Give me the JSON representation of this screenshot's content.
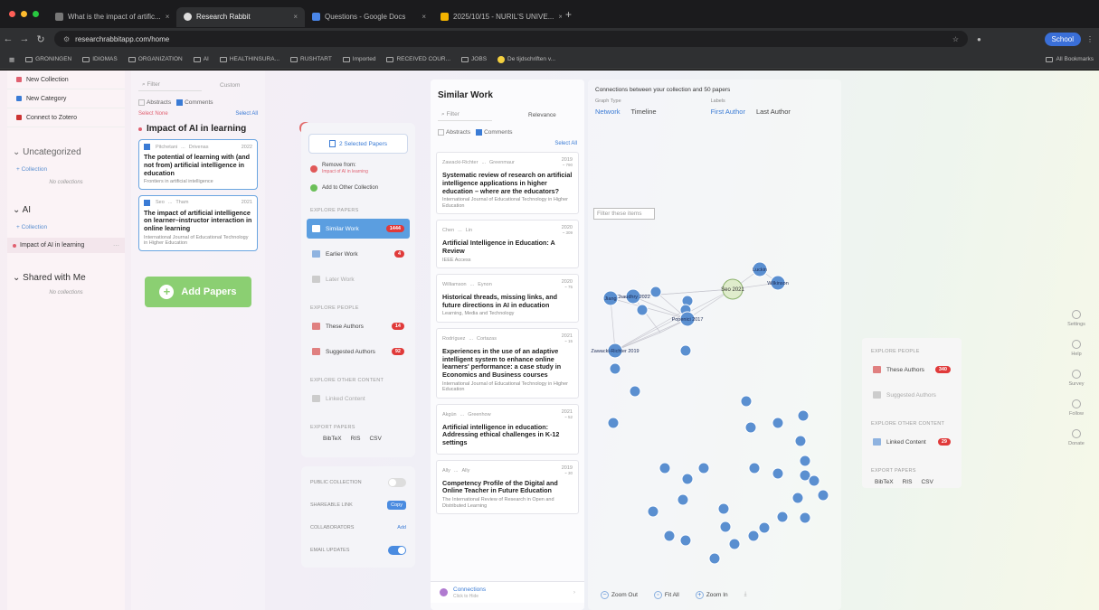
{
  "browser": {
    "tabs": [
      {
        "title": "What is the impact of artific...",
        "active": false
      },
      {
        "title": "Research Rabbit",
        "active": true
      },
      {
        "title": "Questions - Google Docs",
        "active": false
      },
      {
        "title": "2025/10/15 - NURIL'S UNIVE...",
        "active": false
      }
    ],
    "url": "researchrabbitapp.com/home",
    "profile_label": "School",
    "bookmarks": [
      "GRONINGEN",
      "IDIOMAS",
      "ORGANIZATION",
      "AI",
      "HEALTHINSURA...",
      "RUSHTART",
      "Imported",
      "RECEIVED COUR...",
      "JOBS",
      "De tijdschriften v..."
    ],
    "all_bookmarks": "All Bookmarks"
  },
  "sidebar": {
    "actions": [
      "New Collection",
      "New Category",
      "Connect to Zotero"
    ],
    "sections": [
      {
        "title": "Uncategorized",
        "add": "+ Collection",
        "empty": "No collections"
      },
      {
        "title": "AI",
        "add": "+ Collection",
        "item": "Impact of AI in learning"
      },
      {
        "title": "Shared with Me",
        "empty": "No collections"
      }
    ]
  },
  "collection": {
    "filter_placeholder": "Filter",
    "sort": "Custom",
    "abstracts": "Abstracts",
    "comments": "Comments",
    "select_none": "Select None",
    "select_all": "Select All",
    "title": "Impact of AI in learning",
    "papers": [
      {
        "authors": [
          "Pitchetani",
          "Drivenas"
        ],
        "year": "2022",
        "title": "The potential of learning with (and not from) artificial intelligence in education",
        "journal": "Frontiers in artificial intelligence"
      },
      {
        "authors": [
          "Seo",
          "Tham"
        ],
        "year": "2021",
        "title": "The impact of artificial intelligence on learner–instructor interaction in online learning",
        "journal": "International Journal of Educational Technology in Higher Education"
      }
    ],
    "add_papers": "Add Papers"
  },
  "selection": {
    "selected_label": "2 Selected Papers",
    "remove_label": "Remove from:",
    "remove_sub": "Impact of AI in learning",
    "add_other": "Add to Other Collection",
    "explore_papers": "EXPLORE PAPERS",
    "similar_work": "Similar Work",
    "similar_count": "1444",
    "earlier_work": "Earlier Work",
    "earlier_count": "4",
    "later_work": "Later Work",
    "explore_people": "EXPLORE PEOPLE",
    "these_authors": "These Authors",
    "these_count": "14",
    "suggested_authors": "Suggested Authors",
    "suggested_count": "92",
    "explore_other": "EXPLORE OTHER CONTENT",
    "linked_content": "Linked Content",
    "export_papers": "EXPORT PAPERS",
    "export": [
      "BibTeX",
      "RIS",
      "CSV"
    ]
  },
  "settings": {
    "public": "PUBLIC COLLECTION",
    "share": "SHAREABLE LINK",
    "copy": "Copy",
    "collaborators": "COLLABORATORS",
    "collab_action": "Add",
    "email": "EMAIL UPDATES"
  },
  "similar": {
    "title": "Similar Work",
    "filter": "Filter",
    "sort": "Relevance",
    "abstracts": "Abstracts",
    "comments": "Comments",
    "select_all": "Select All",
    "papers": [
      {
        "authors": [
          "Zawacki-Richter",
          "Greenmaur"
        ],
        "year": "2019",
        "cites": "~ 790",
        "title": "Systematic review of research on artificial intelligence applications in higher education – where are the educators?",
        "journal": "International Journal of Educational Technology in Higher Education"
      },
      {
        "authors": [
          "Chen",
          "Lin"
        ],
        "year": "2020",
        "cites": "~ 309",
        "title": "Artificial Intelligence in Education: A Review",
        "journal": "IEEE Access"
      },
      {
        "authors": [
          "Williamson",
          "Eynon"
        ],
        "year": "2020",
        "cites": "~ 75",
        "title": "Historical threads, missing links, and future directions in AI in education",
        "journal": "Learning, Media and Technology"
      },
      {
        "authors": [
          "Rodríguez",
          "Cortazas"
        ],
        "year": "2021",
        "cites": "~ 15",
        "title": "Experiences in the use of an adaptive intelligent system to enhance online learners' performance: a case study in Economics and Business courses",
        "journal": "International Journal of Educational Technology in Higher Education"
      },
      {
        "authors": [
          "Akgün",
          "Greenhow"
        ],
        "year": "2021",
        "cites": "~ 52",
        "title": "Artificial intelligence in education: Addressing ethical challenges in K-12 settings",
        "journal": ""
      },
      {
        "authors": [
          "Ally",
          "Ally"
        ],
        "year": "2019",
        "cites": "~ 30",
        "title": "Competency Profile of the Digital and Online Teacher in Future Education",
        "journal": "The International Review of Research in Open and Distributed Learning"
      }
    ],
    "connections": "Connections",
    "connections_sub": "Click to Hide"
  },
  "graph": {
    "header": "Connections between your collection and 50 papers",
    "graph_type": "Graph Type",
    "network": "Network",
    "timeline": "Timeline",
    "labels": "Labels",
    "first_author": "First Author",
    "last_author": "Last Author",
    "filter_placeholder": "Filter these items",
    "nodes": [
      {
        "label": "Seo 2021",
        "highlight": true
      },
      {
        "label": "Popenici 2017"
      },
      {
        "label": "Zawacki-Richter 2019"
      },
      {
        "label": "Chaudhry 2022"
      },
      {
        "label": "Jiang"
      },
      {
        "label": "Luckin"
      },
      {
        "label": "Wilkinson"
      }
    ],
    "zoom_out": "Zoom Out",
    "fit_all": "Fit All",
    "zoom_in": "Zoom In"
  },
  "people": {
    "explore_people": "EXPLORE PEOPLE",
    "these_authors": "These Authors",
    "these_count": "340",
    "suggested_authors": "Suggested Authors",
    "explore_other": "EXPLORE OTHER CONTENT",
    "linked_content": "Linked Content",
    "linked_count": "29",
    "export_papers": "EXPORT PAPERS",
    "export": [
      "BibTeX",
      "RIS",
      "CSV"
    ]
  },
  "rightbar": [
    "Settings",
    "Help",
    "Survey",
    "Follow",
    "Donate"
  ]
}
